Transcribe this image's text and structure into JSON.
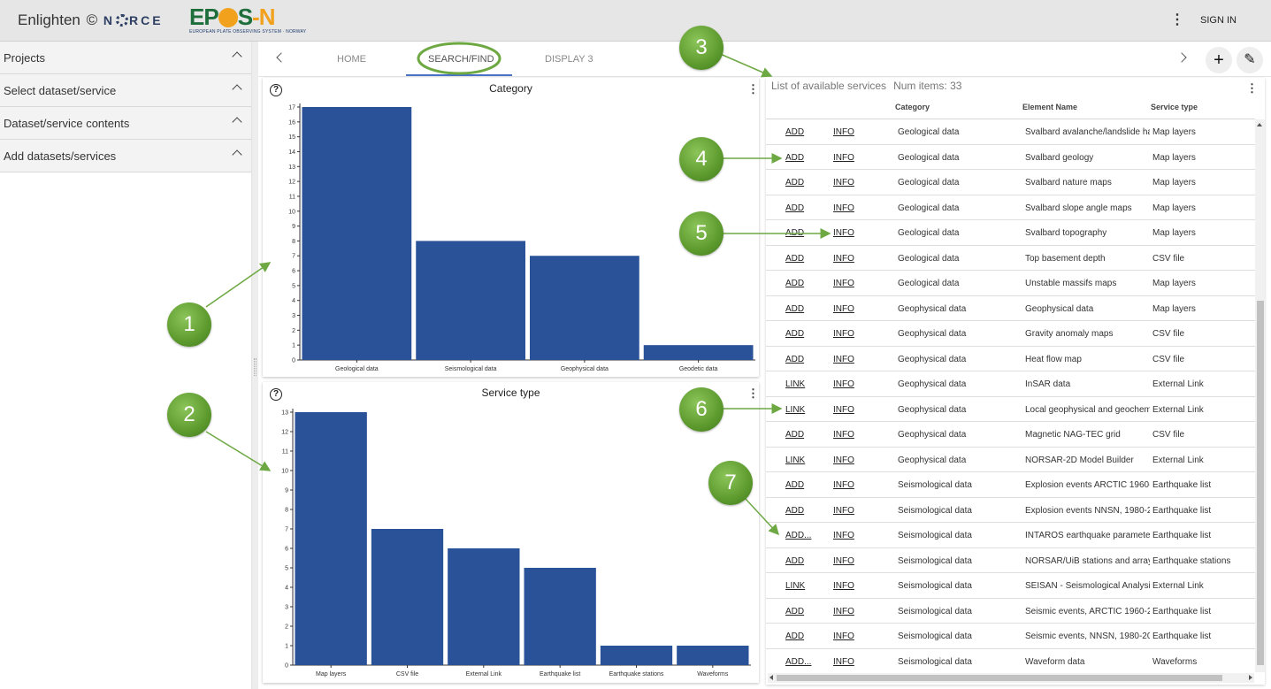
{
  "header": {
    "brand_text": "Enlighten",
    "brand_copy": "©",
    "norce_pre": "N",
    "norce_post": "RCE",
    "epos_a": "EP",
    "epos_b": "S",
    "epos_c": "-",
    "epos_d": "N",
    "epos_sub": "EUROPEAN PLATE OBSERVING SYSTEM  ·  NORWAY",
    "menu_icon": "⋮",
    "signin_label": "SIGN IN"
  },
  "sidebar": {
    "items": [
      {
        "label": "Projects"
      },
      {
        "label": "Select dataset/service"
      },
      {
        "label": "Dataset/service contents"
      },
      {
        "label": "Add datasets/services"
      }
    ]
  },
  "tabs": {
    "items": [
      {
        "label": "HOME"
      },
      {
        "label": "SEARCH/FIND"
      },
      {
        "label": "DISPLAY 3"
      }
    ],
    "active_index": 1,
    "add_label": "+",
    "edit_label": "✎"
  },
  "panels": {
    "help_icon": "?",
    "kebab_icon": "⋮"
  },
  "chart_data": [
    {
      "type": "bar",
      "title": "Category",
      "categories": [
        "Geological data",
        "Seismological data",
        "Geophysical data",
        "Geodetic data"
      ],
      "values": [
        17,
        8,
        7,
        1
      ],
      "ylim": [
        0,
        17
      ],
      "yticks": [
        0,
        1,
        2,
        3,
        4,
        5,
        6,
        7,
        8,
        9,
        10,
        11,
        12,
        13,
        14,
        15,
        16,
        17
      ],
      "color": "#2a5299"
    },
    {
      "type": "bar",
      "title": "Service type",
      "categories": [
        "Map layers",
        "CSV file",
        "External Link",
        "Earthquake list",
        "Earthquake stations",
        "Waveforms"
      ],
      "values": [
        13,
        7,
        6,
        5,
        1,
        1
      ],
      "ylim": [
        0,
        13
      ],
      "yticks": [
        0,
        1,
        2,
        3,
        4,
        5,
        6,
        7,
        8,
        9,
        10,
        11,
        12,
        13
      ],
      "color": "#2a5299"
    }
  ],
  "list": {
    "title": "List of available services",
    "count_label": "Num items: 33",
    "columns": [
      "",
      "",
      "Category",
      "Element Name",
      "Service type"
    ],
    "rows": [
      [
        "ADD",
        "INFO",
        "Geological data",
        "Svalbard avalanche/landslide ha",
        "Map layers"
      ],
      [
        "ADD",
        "INFO",
        "Geological data",
        "Svalbard geology",
        "Map layers"
      ],
      [
        "ADD",
        "INFO",
        "Geological data",
        "Svalbard nature maps",
        "Map layers"
      ],
      [
        "ADD",
        "INFO",
        "Geological data",
        "Svalbard slope angle maps",
        "Map layers"
      ],
      [
        "ADD",
        "INFO",
        "Geological data",
        "Svalbard topography",
        "Map layers"
      ],
      [
        "ADD",
        "INFO",
        "Geological data",
        "Top basement depth",
        "CSV file"
      ],
      [
        "ADD",
        "INFO",
        "Geological data",
        "Unstable massifs maps",
        "Map layers"
      ],
      [
        "ADD",
        "INFO",
        "Geophysical data",
        "Geophysical data",
        "Map layers"
      ],
      [
        "ADD",
        "INFO",
        "Geophysical data",
        "Gravity anomaly maps",
        "CSV file"
      ],
      [
        "ADD",
        "INFO",
        "Geophysical data",
        "Heat flow map",
        "CSV file"
      ],
      [
        "LINK",
        "INFO",
        "Geophysical data",
        "InSAR data",
        "External Link"
      ],
      [
        "LINK",
        "INFO",
        "Geophysical data",
        "Local geophysical and geochem",
        "External Link"
      ],
      [
        "ADD",
        "INFO",
        "Geophysical data",
        "Magnetic NAG-TEC grid",
        "CSV file"
      ],
      [
        "LINK",
        "INFO",
        "Geophysical data",
        "NORSAR-2D Model Builder",
        "External Link"
      ],
      [
        "ADD",
        "INFO",
        "Seismological data",
        "Explosion events ARCTIC 1960-",
        "Earthquake list"
      ],
      [
        "ADD",
        "INFO",
        "Seismological data",
        "Explosion events NNSN, 1980-2",
        "Earthquake list"
      ],
      [
        "ADD...",
        "INFO",
        "Seismological data",
        "INTAROS earthquake parameter",
        "Earthquake list"
      ],
      [
        "ADD",
        "INFO",
        "Seismological data",
        "NORSAR/UiB stations and array",
        "Earthquake stations"
      ],
      [
        "LINK",
        "INFO",
        "Seismological data",
        "SEISAN - Seismological Analysis",
        "External Link"
      ],
      [
        "ADD",
        "INFO",
        "Seismological data",
        "Seismic events, ARCTIC 1960-2",
        "Earthquake list"
      ],
      [
        "ADD",
        "INFO",
        "Seismological data",
        "Seismic events, NNSN, 1980-20",
        "Earthquake list"
      ],
      [
        "ADD...",
        "INFO",
        "Seismological data",
        "Waveform data",
        "Waveforms"
      ]
    ]
  },
  "annotations": [
    "1",
    "2",
    "3",
    "4",
    "5",
    "6",
    "7"
  ],
  "colors": {
    "bar": "#2a5299",
    "annotation": "#5d9a2e",
    "tab_underline": "#4a73c8",
    "highlight_ring": "#6ea843"
  }
}
